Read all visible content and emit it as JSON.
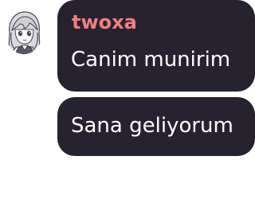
{
  "messages": [
    {
      "author": "twoxa",
      "author_color": "#f08080",
      "text": "Canim munirim",
      "avatar_icon": "anime-girl-avatar"
    },
    {
      "text": "Sana geliyorum"
    }
  ],
  "colors": {
    "bubble_bg": "#27222f",
    "text": "#ffffff",
    "page_bg": "#ffffff"
  }
}
